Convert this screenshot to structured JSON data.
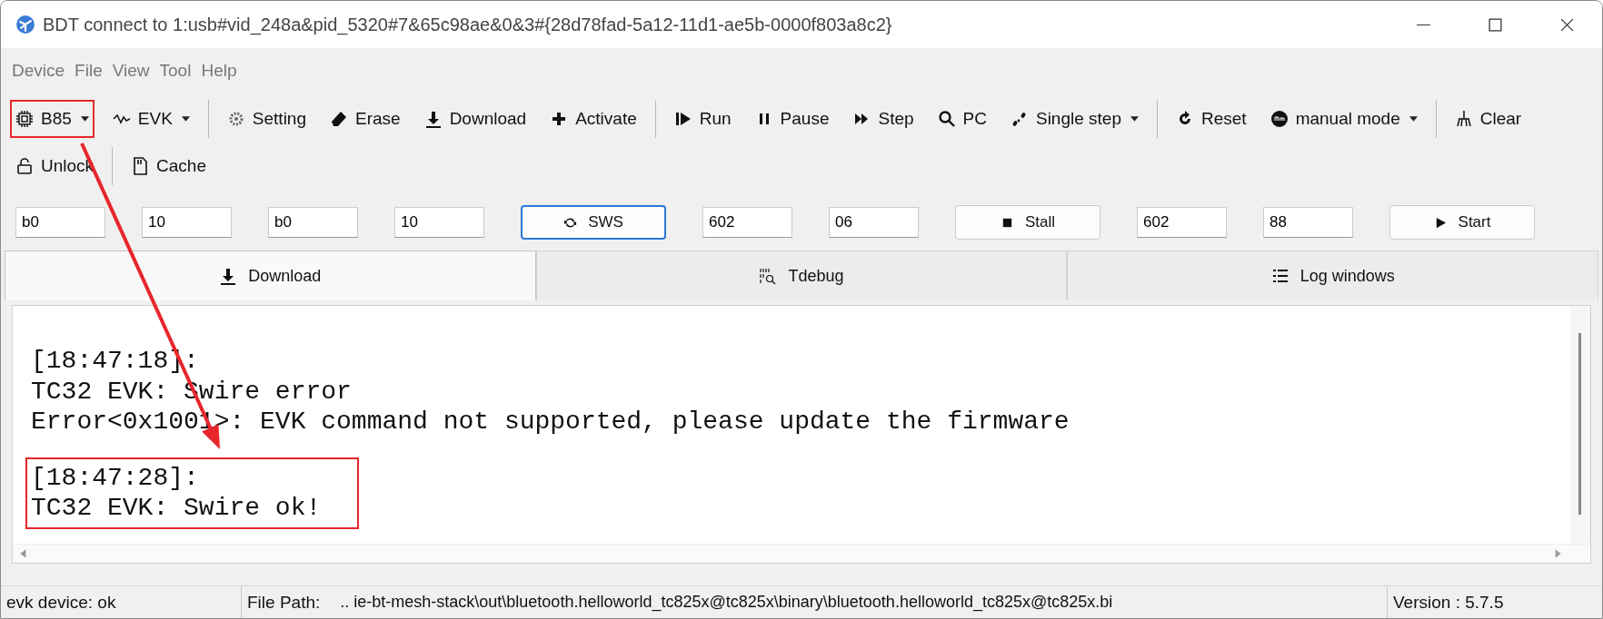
{
  "window": {
    "title": "BDT connect to 1:usb#vid_248a&pid_5320#7&65c98ae&0&3#{28d78fad-5a12-11d1-ae5b-0000f803a8c2}"
  },
  "menu": [
    "Device",
    "File",
    "View",
    "Tool",
    "Help"
  ],
  "toolbar_rows": [
    [
      {
        "kind": "button",
        "label": "B85",
        "dropdown": true,
        "highlighted": true
      },
      {
        "kind": "button",
        "label": "EVK",
        "dropdown": true,
        "highlighted": false
      },
      {
        "kind": "separator"
      },
      {
        "kind": "button",
        "label": "Setting",
        "dropdown": false,
        "highlighted": false
      },
      {
        "kind": "button",
        "label": "Erase",
        "dropdown": false,
        "highlighted": false
      },
      {
        "kind": "button",
        "label": "Download",
        "dropdown": false,
        "highlighted": false
      },
      {
        "kind": "button",
        "label": "Activate",
        "dropdown": false,
        "highlighted": false
      },
      {
        "kind": "separator"
      },
      {
        "kind": "button",
        "label": "Run",
        "dropdown": false,
        "highlighted": false
      },
      {
        "kind": "button",
        "label": "Pause",
        "dropdown": false,
        "highlighted": false
      },
      {
        "kind": "button",
        "label": "Step",
        "dropdown": false,
        "highlighted": false
      },
      {
        "kind": "button",
        "label": "PC",
        "dropdown": false,
        "highlighted": false
      },
      {
        "kind": "button",
        "label": "Single step",
        "dropdown": true,
        "highlighted": false
      },
      {
        "kind": "separator"
      },
      {
        "kind": "button",
        "label": "Reset",
        "dropdown": false,
        "highlighted": false
      },
      {
        "kind": "button",
        "label": "manual mode",
        "dropdown": true,
        "highlighted": false
      },
      {
        "kind": "separator"
      },
      {
        "kind": "button",
        "label": "Clear",
        "dropdown": false,
        "highlighted": false
      }
    ],
    [
      {
        "kind": "button",
        "label": "Unlock",
        "dropdown": false,
        "highlighted": false
      },
      {
        "kind": "separator"
      },
      {
        "kind": "button",
        "label": "Cache",
        "dropdown": false,
        "highlighted": false
      }
    ]
  ],
  "controls": [
    {
      "kind": "field",
      "value": "b0"
    },
    {
      "kind": "field",
      "value": "10"
    },
    {
      "kind": "field",
      "value": "b0"
    },
    {
      "kind": "field",
      "value": "10"
    },
    {
      "kind": "button",
      "label": "SWS",
      "focused": true
    },
    {
      "kind": "field",
      "value": "602"
    },
    {
      "kind": "field",
      "value": "06"
    },
    {
      "kind": "button",
      "label": "Stall",
      "focused": false
    },
    {
      "kind": "field",
      "value": "602"
    },
    {
      "kind": "field",
      "value": "88"
    },
    {
      "kind": "button",
      "label": "Start",
      "focused": false
    }
  ],
  "tabs": [
    {
      "label": "Download",
      "selected": true
    },
    {
      "label": "Tdebug",
      "selected": false
    },
    {
      "label": "Log windows",
      "selected": false
    }
  ],
  "log": [
    {
      "lines": [
        "[18:47:18]:",
        "TC32 EVK: Swire error",
        "Error<0x1001>: EVK command not supported, please update the firmware"
      ],
      "highlighted": false
    },
    {
      "lines": [
        "[18:47:28]:",
        "TC32 EVK: Swire ok!"
      ],
      "highlighted": true
    }
  ],
  "status_bar": {
    "device": "evk device: ok",
    "path_label": "File Path:",
    "path": "..  ie-bt-mesh-stack\\out\\bluetooth.helloworld_tc825x@tc825x\\binary\\bluetooth.helloworld_tc825x@tc825x.bi",
    "version": "Version : 5.7.5"
  }
}
